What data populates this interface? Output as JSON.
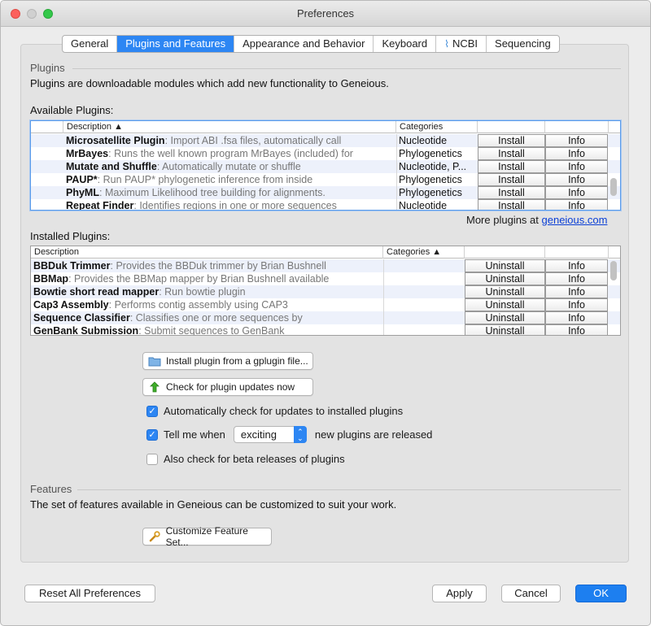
{
  "window": {
    "title": "Preferences"
  },
  "tabs": [
    {
      "label": "General",
      "active": false
    },
    {
      "label": "Plugins and Features",
      "active": true
    },
    {
      "label": "Appearance and Behavior",
      "active": false
    },
    {
      "label": "Keyboard",
      "active": false
    },
    {
      "label": "NCBI",
      "active": false,
      "icon": "ncbi-helix-icon"
    },
    {
      "label": "Sequencing",
      "active": false
    }
  ],
  "plugins": {
    "section_title": "Plugins",
    "intro": "Plugins are downloadable modules which add new functionality to Geneious.",
    "available_label": "Available Plugins:",
    "available": {
      "columns": {
        "description": "Description ▲",
        "categories": "Categories"
      },
      "rows": [
        {
          "name": "Microsatellite Plugin",
          "sep": ": ",
          "desc": "Import ABI .fsa files, automatically call",
          "category": "Nucleotide",
          "install": "Install",
          "info": "Info"
        },
        {
          "name": "MrBayes",
          "sep": ": ",
          "desc": "Runs the well known program MrBayes (included) for",
          "category": "Phylogenetics",
          "install": "Install",
          "info": "Info"
        },
        {
          "name": "Mutate and Shuffle",
          "sep": ": ",
          "desc": "Automatically mutate or shuffle",
          "category": "Nucleotide, P...",
          "install": "Install",
          "info": "Info"
        },
        {
          "name": "PAUP*",
          "sep": ": ",
          "desc": "Run PAUP* phylogenetic inference from inside",
          "category": "Phylogenetics",
          "install": "Install",
          "info": "Info"
        },
        {
          "name": "PhyML",
          "sep": ": ",
          "desc": "Maximum Likelihood tree building for alignments.",
          "category": "Phylogenetics",
          "install": "Install",
          "info": "Info"
        },
        {
          "name": "Repeat Finder",
          "sep": ": ",
          "desc": "Identifies regions in one or more sequences",
          "category": "Nucleotide",
          "install": "Install",
          "info": "Info"
        }
      ]
    },
    "more_prefix": "More plugins at ",
    "more_link": "geneious.com",
    "installed_label": "Installed Plugins:",
    "installed": {
      "columns": {
        "description": "Description",
        "categories": "Categories ▲"
      },
      "rows": [
        {
          "name": "BBDuk Trimmer",
          "sep": ": ",
          "desc": "Provides the BBDuk trimmer by Brian Bushnell",
          "category": "",
          "uninstall": "Uninstall",
          "info": "Info"
        },
        {
          "name": "BBMap",
          "sep": ": ",
          "desc": "Provides the BBMap mapper by Brian Bushnell available",
          "category": "",
          "uninstall": "Uninstall",
          "info": "Info"
        },
        {
          "name": "Bowtie short read mapper",
          "sep": ": ",
          "desc": "Run bowtie plugin",
          "category": "",
          "uninstall": "Uninstall",
          "info": "Info"
        },
        {
          "name": "Cap3 Assembly",
          "sep": ": ",
          "desc": "Performs contig assembly using CAP3",
          "category": "",
          "uninstall": "Uninstall",
          "info": "Info"
        },
        {
          "name": "Sequence Classifier",
          "sep": ": ",
          "desc": "Classifies one or more sequences by",
          "category": "",
          "uninstall": "Uninstall",
          "info": "Info"
        },
        {
          "name": "GenBank Submission",
          "sep": ": ",
          "desc": "Submit sequences to GenBank",
          "category": "",
          "uninstall": "Uninstall",
          "info": "Info"
        }
      ]
    },
    "install_file_button": "Install plugin from a gplugin file...",
    "check_updates_button": "Check for plugin updates now",
    "auto_check_label": "Automatically check for updates to installed plugins",
    "auto_check_checked": true,
    "tell_me_prefix": "Tell me when",
    "tell_me_checked": true,
    "tell_me_option": "exciting",
    "tell_me_suffix": "new plugins are released",
    "beta_label": "Also check for beta releases of plugins",
    "beta_checked": false
  },
  "features": {
    "section_title": "Features",
    "intro": "The set of features available in Geneious can be customized to suit your work.",
    "customize_button": "Customize Feature Set..."
  },
  "footer": {
    "reset": "Reset All Preferences",
    "apply": "Apply",
    "cancel": "Cancel",
    "ok": "OK"
  },
  "colors": {
    "accent": "#2d86f3",
    "link": "#0a3fd6",
    "row_alt": "#edf1fb"
  }
}
